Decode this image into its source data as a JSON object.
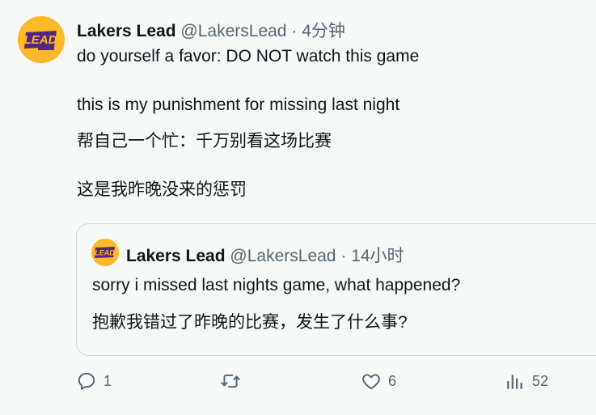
{
  "tweet": {
    "author_name": "Lakers Lead",
    "handle": "@LakersLead",
    "separator": "·",
    "time": "4分钟",
    "line1": "do yourself a favor: DO NOT watch this game",
    "line2": "this is my punishment for missing last night",
    "line3": "帮自己一个忙：千万别看这场比赛",
    "line4": "这是我昨晚没来的惩罚"
  },
  "avatar": {
    "logo_text": "LEAD",
    "logo_subtext": "LAKERS",
    "bg_color": "#fdb927",
    "fg_color": "#552583"
  },
  "quoted": {
    "author_name": "Lakers Lead",
    "handle": "@LakersLead",
    "separator": "·",
    "time": "14小时",
    "line1": "sorry i missed last nights game, what happened?",
    "line2": "抱歉我错过了昨晚的比赛，发生了什么事?"
  },
  "actions": {
    "reply_count": "1",
    "retweet_count": "",
    "like_count": "6",
    "views_count": "52"
  },
  "icons": {
    "reply": "reply-icon",
    "retweet": "retweet-icon",
    "like": "heart-icon",
    "views": "views-icon"
  }
}
